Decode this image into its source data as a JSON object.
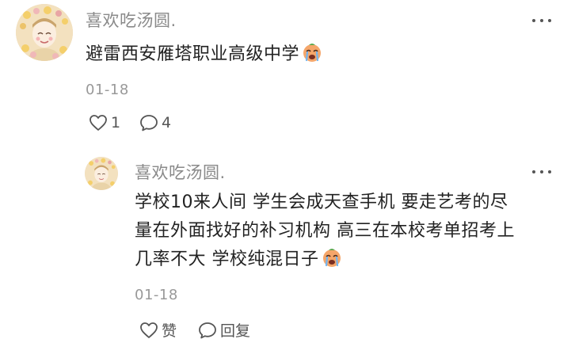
{
  "comment": {
    "username": "喜欢吃汤圆.",
    "text": "避雷西安雁塔职业高级中学",
    "emoji": "crying-face-emoji",
    "date": "01-18",
    "likes": "1",
    "replies": "4"
  },
  "reply": {
    "username": "喜欢吃汤圆.",
    "lines": [
      "学校10来人间 学生会成天查手机 要走艺考的尽",
      "量在外面找好的补习机构 高三在本校考单招考上",
      "几率不大 学校纯混日子"
    ],
    "emoji": "crying-face-emoji",
    "date": "01-18",
    "like_label": "赞",
    "reply_label": "回复"
  },
  "colors": {
    "username": "#8a8a8a",
    "text": "#222222",
    "meta": "#999999",
    "icon": "#555555"
  }
}
